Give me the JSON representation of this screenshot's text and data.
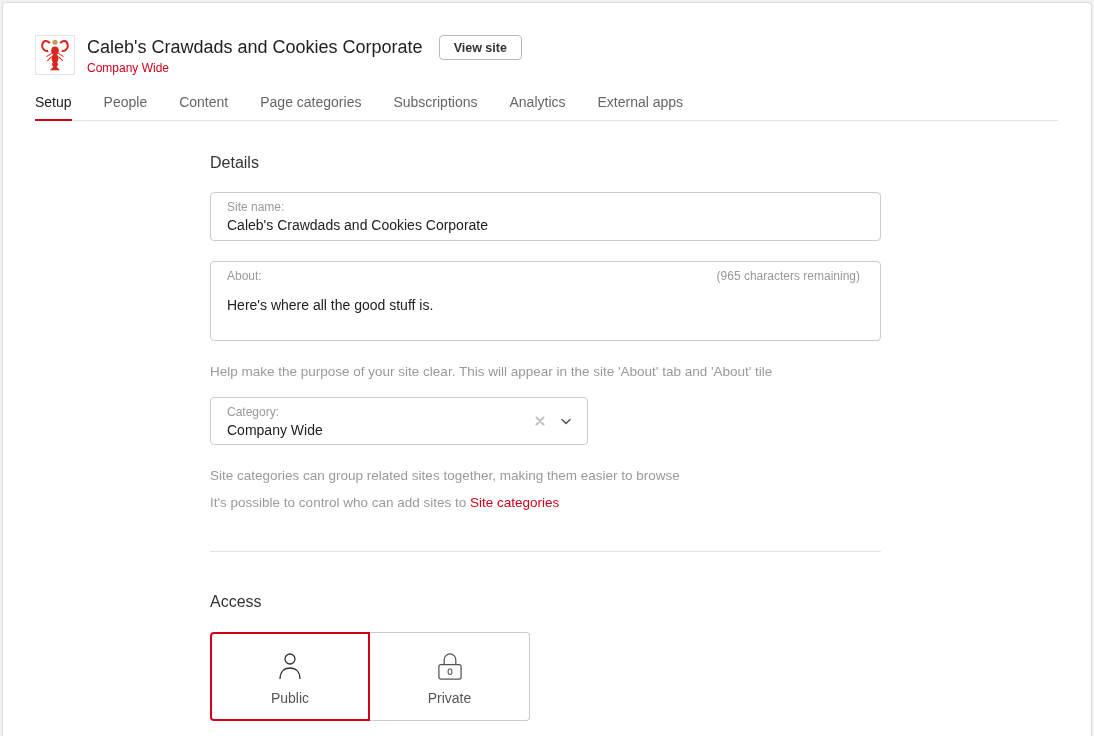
{
  "site": {
    "title": "Caleb's Crawdads and Cookies Corporate",
    "subtitle": "Company Wide",
    "view_button": "View site"
  },
  "tabs": [
    {
      "label": "Setup",
      "selected": true
    },
    {
      "label": "People",
      "selected": false
    },
    {
      "label": "Content",
      "selected": false
    },
    {
      "label": "Page categories",
      "selected": false
    },
    {
      "label": "Subscriptions",
      "selected": false
    },
    {
      "label": "Analytics",
      "selected": false
    },
    {
      "label": "External apps",
      "selected": false
    }
  ],
  "details": {
    "heading": "Details",
    "site_name": {
      "label": "Site name:",
      "value": "Caleb's Crawdads and Cookies Corporate"
    },
    "about": {
      "label": "About:",
      "counter": "(965 characters remaining)",
      "value": "Here's where all the good stuff is."
    },
    "about_help": "Help make the purpose of your site clear. This will appear in the site 'About' tab and 'About' tile",
    "category": {
      "label": "Category:",
      "value": "Company Wide"
    },
    "category_help": "Site categories can group related sites together, making them easier to browse",
    "permission_note": {
      "text": "It's possible to control who can add sites to ",
      "link": "Site categories"
    }
  },
  "access": {
    "heading": "Access",
    "options": [
      {
        "label": "Public",
        "kind": "public",
        "selected": true
      },
      {
        "label": "Private",
        "kind": "private",
        "selected": false
      }
    ]
  }
}
